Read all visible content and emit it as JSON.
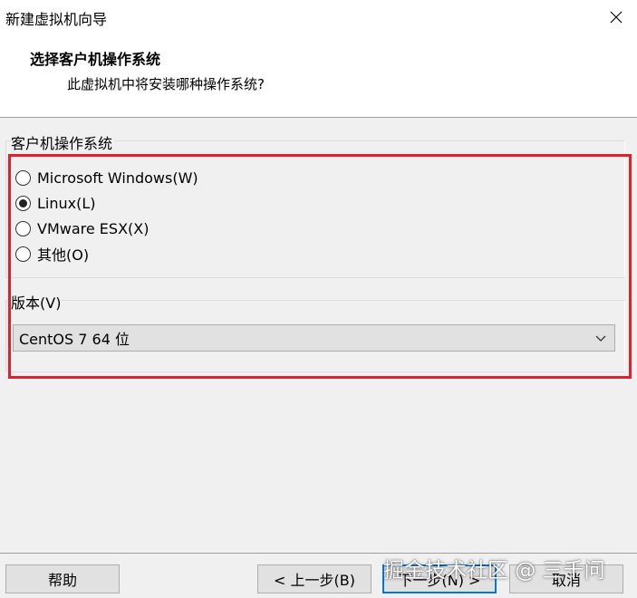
{
  "window": {
    "title": "新建虚拟机向导",
    "close_icon": "close-icon"
  },
  "header": {
    "title": "选择客户机操作系统",
    "subtitle": "此虚拟机中将安装哪种操作系统?"
  },
  "guest_os": {
    "group_label": "客户机操作系统",
    "options": [
      {
        "label": "Microsoft Windows(W)",
        "selected": false
      },
      {
        "label": "Linux(L)",
        "selected": true
      },
      {
        "label": "VMware ESX(X)",
        "selected": false
      },
      {
        "label": "其他(O)",
        "selected": false
      }
    ]
  },
  "version": {
    "label": "版本(V)",
    "selected": "CentOS 7 64 位"
  },
  "highlight_color": "#e0202e",
  "footer": {
    "help": "帮助",
    "back": "< 上一步(B)",
    "next": "下一步(N) >",
    "cancel": "取消"
  },
  "watermark": "掘金技术社区 @ 三千问"
}
